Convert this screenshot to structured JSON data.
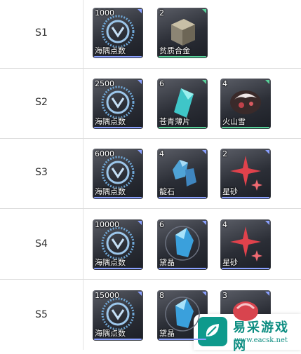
{
  "rows": [
    {
      "stage": "S1",
      "items": [
        {
          "count": "1000",
          "name": "海隅点数",
          "icon": "currency-emblem-icon",
          "accent": "#8aa0ff"
        },
        {
          "count": "2",
          "name": "贫质合金",
          "icon": "alloy-cube-icon",
          "accent": "#58d29a"
        }
      ]
    },
    {
      "stage": "S2",
      "items": [
        {
          "count": "2500",
          "name": "海隅点数",
          "icon": "currency-emblem-icon",
          "accent": "#8aa0ff"
        },
        {
          "count": "6",
          "name": "苍青薄片",
          "icon": "cyan-shard-icon",
          "accent": "#58d29a"
        },
        {
          "count": "4",
          "name": "火山雪",
          "icon": "volcanic-rock-icon",
          "accent": "#58d29a"
        }
      ]
    },
    {
      "stage": "S3",
      "items": [
        {
          "count": "6000",
          "name": "海隅点数",
          "icon": "currency-emblem-icon",
          "accent": "#8aa0ff"
        },
        {
          "count": "4",
          "name": "靛石",
          "icon": "blue-stone-icon",
          "accent": "#8aa0ff"
        },
        {
          "count": "2",
          "name": "星砂",
          "icon": "red-star-icon",
          "accent": "#8aa0ff"
        }
      ]
    },
    {
      "stage": "S4",
      "items": [
        {
          "count": "10000",
          "name": "海隅点数",
          "icon": "currency-emblem-icon",
          "accent": "#8aa0ff"
        },
        {
          "count": "6",
          "name": "黛晶",
          "icon": "blue-crystal-icon",
          "accent": "#8aa0ff"
        },
        {
          "count": "4",
          "name": "星砂",
          "icon": "red-star-icon",
          "accent": "#8aa0ff"
        }
      ]
    },
    {
      "stage": "S5",
      "items": [
        {
          "count": "15000",
          "name": "海隅点数",
          "icon": "currency-emblem-icon",
          "accent": "#8aa0ff"
        },
        {
          "count": "8",
          "name": "黛晶",
          "icon": "blue-crystal-icon",
          "accent": "#8aa0ff"
        },
        {
          "count": "3",
          "name": "",
          "icon": "red-gem-icon",
          "accent": "#8aa0ff"
        }
      ]
    }
  ],
  "watermark": {
    "title": "易采游戏网",
    "url": "www.eacsk.net",
    "icon": "leaf-logo-icon"
  }
}
